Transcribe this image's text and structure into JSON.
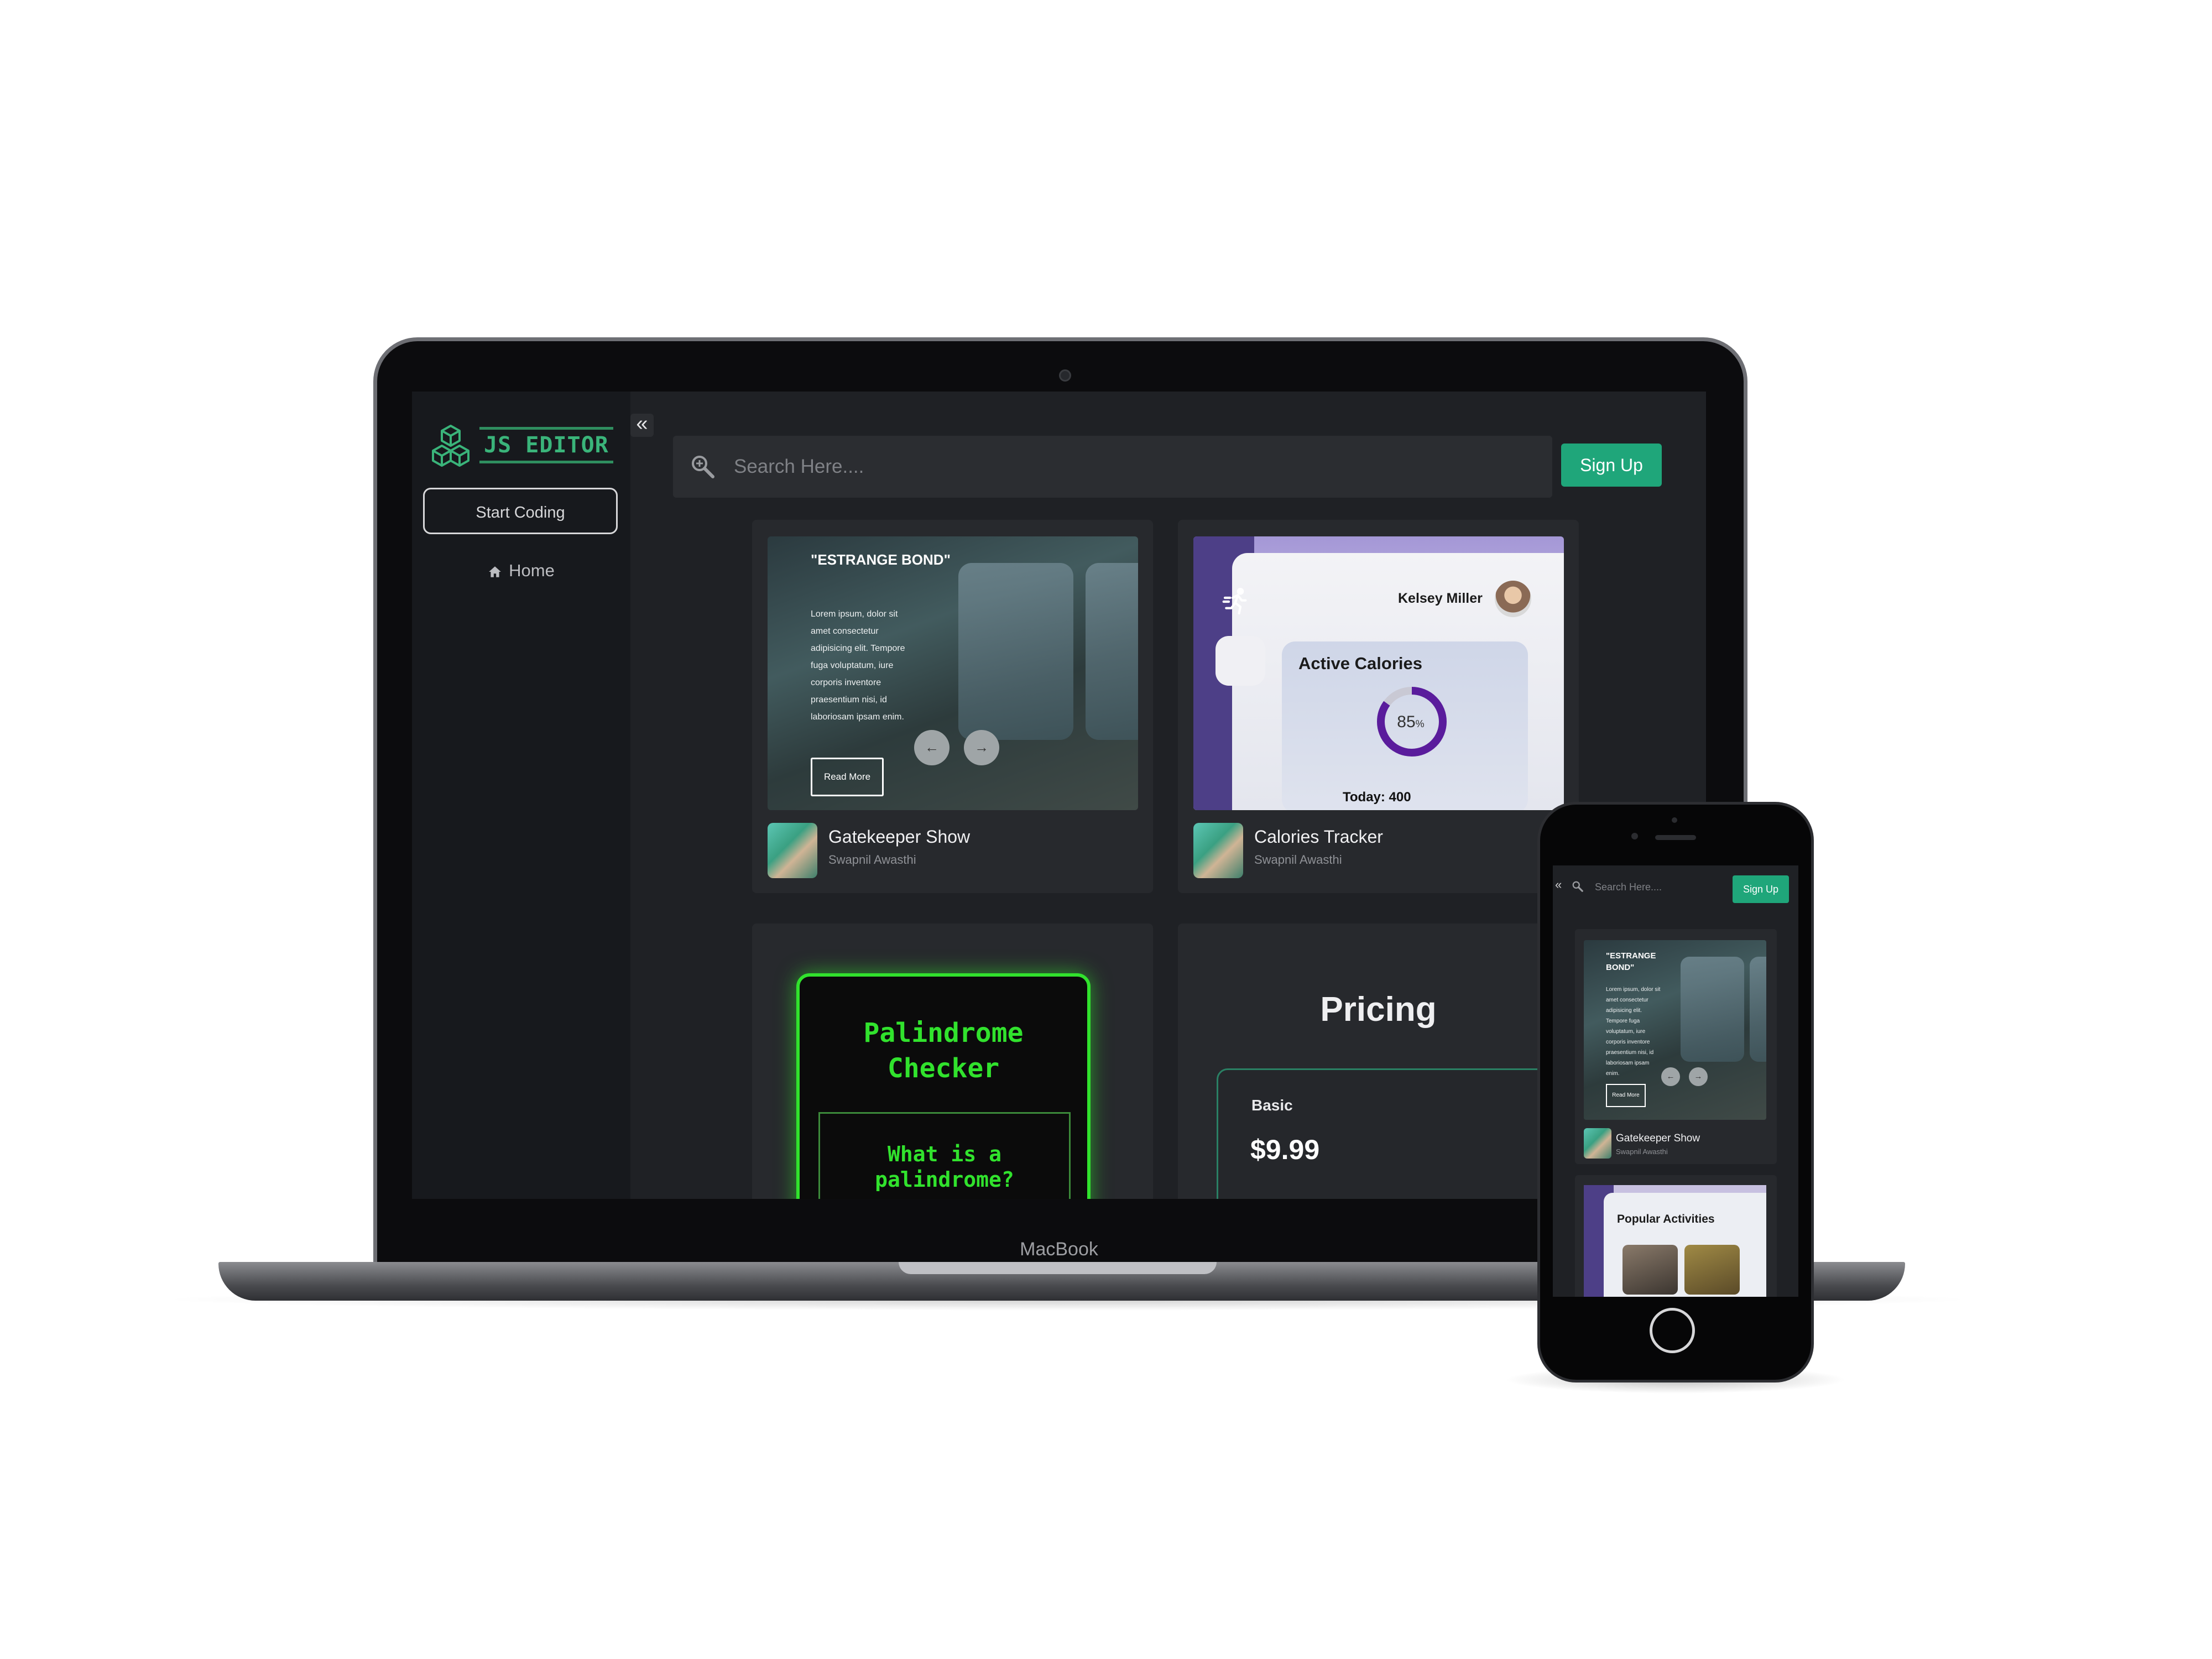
{
  "laptop": {
    "brand": "MacBook",
    "sidebar": {
      "logo_text": "JS EDITOR",
      "start_button": "Start Coding",
      "nav": [
        {
          "label": "Home",
          "icon": "home-icon"
        }
      ],
      "collapse_icon": "double-chevron-left-icon"
    },
    "topbar": {
      "search_placeholder": "Search Here....",
      "search_icon": "search-icon",
      "signup_label": "Sign Up"
    },
    "cards": [
      {
        "title": "Gatekeeper Show",
        "author": "Swapnil Awasthi",
        "preview": {
          "heading": "\"ESTRANGE BOND\"",
          "body": "Lorem ipsum, dolor sit amet consectetur adipisicing elit. Tempore fuga voluptatum, iure corporis inventore praesentium nisi, id laboriosam ipsam enim.",
          "button": "Read More",
          "prev_icon": "arrow-left-icon",
          "next_icon": "arrow-right-icon"
        }
      },
      {
        "title": "Calories Tracker",
        "author": "Swapnil Awasthi",
        "preview": {
          "user_name": "Kelsey Miller",
          "heading": "Active Calories",
          "percent_number": "85",
          "percent_unit": "%",
          "percent_value": 0.85,
          "today": "Today: 400",
          "icon": "running-icon"
        }
      },
      {
        "preview": {
          "heading": "Palindrome Checker",
          "question": "What is a palindrome?"
        }
      },
      {
        "preview": {
          "heading": "Pricing",
          "plan_name": "Basic",
          "plan_price": "$9.99"
        }
      }
    ]
  },
  "phone": {
    "search_placeholder": "Search Here....",
    "signup_label": "Sign Up",
    "card": {
      "title": "Gatekeeper Show",
      "author": "Swapnil Awasthi",
      "heading": "\"ESTRANGE BOND\"",
      "body": "Lorem ipsum, dolor sit amet consectetur adipisicing elit. Tempore fuga voluptatum, iure corporis inventore praesentium nisi, id laboriosam ipsam enim.",
      "button": "Read More"
    },
    "card2": {
      "heading": "Popular Activities"
    }
  },
  "colors": {
    "accent": "#1fa67a",
    "neon": "#31e22d",
    "purple": "#4d3f87",
    "bg": "#1f2125"
  }
}
